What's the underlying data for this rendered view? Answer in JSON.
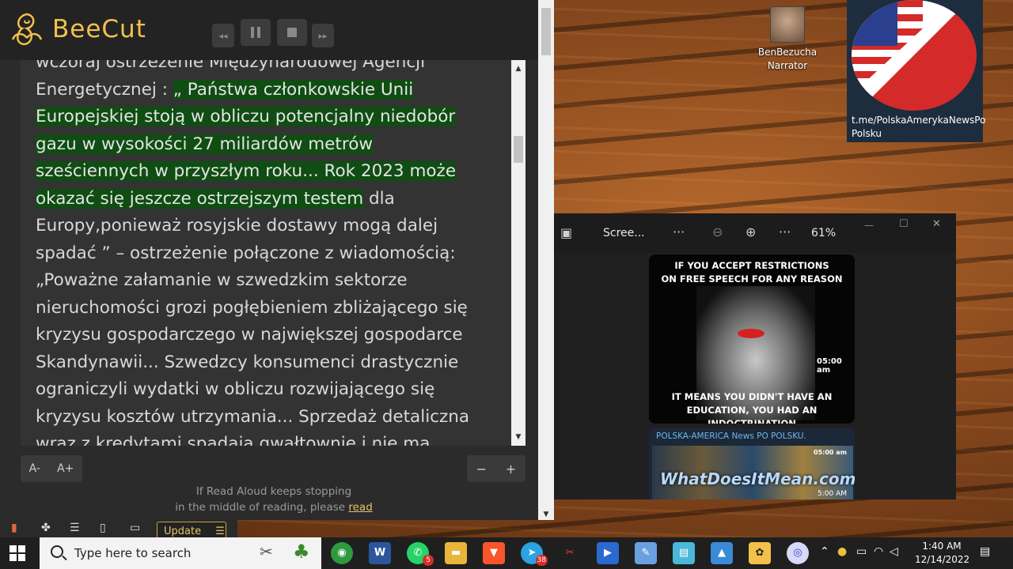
{
  "reader": {
    "app_name": "BeeCut",
    "text_line_first": "wczoraj ostrzeżenie Międzynarodowej Agencji",
    "text_line_2a": "Energetycznej : ",
    "text_hl_1": "„ Państwa członkowskie Unii",
    "text_hl_2": "Europejskiej stoją w obliczu potencjalny niedobór",
    "text_hl_3": "gazu w wysokości 27 miliardów metrów",
    "text_hl_4": "sześciennych w przyszłym roku... Rok 2023 może",
    "text_hl_5": "okazać się jeszcze ostrzejszym testem",
    "text_line_5b": " dla",
    "text_rest": "Europy,ponieważ rosyjskie dostawy mogą dalej\nspadać ” – ostrzeżenie połączone z wiadomością:\n„Poważne załamanie w szwedzkim sektorze\nnieruchomości grozi pogłębieniem zbliżającego się\nkryzysu gospodarczego w największej gospodarce\nSkandynawii... Szwedzcy konsumenci drastycznie\nograniczyli wydatki w obliczu rozwijającego się\nkryzysu kosztów utrzymania... Sprzedaż detaliczna\nwraz z kredytami spadaja gwałtownie i nie ma",
    "font_smaller": "A-",
    "font_larger": "A+",
    "minus": "−",
    "plus": "+",
    "notice_line1": "If Read Aloud keeps stopping",
    "notice_line2": "in the middle of reading, please ",
    "notice_link": "read",
    "update_label": "Update"
  },
  "desktop": {
    "narrator_name": "BenBezucha",
    "narrator_role": "Narrator",
    "flag_label": "t.me/PolskaAmerykaNewsPo Polsku"
  },
  "photos": {
    "title": "Scree...",
    "more1": "···",
    "more2": "···",
    "zoom": "61%",
    "minimize": "—",
    "maximize": "☐",
    "close": "✕",
    "meme_top": "IF YOU ACCEPT RESTRICTIONS\nON FREE SPEECH FOR ANY REASON",
    "meme_bottom": "IT MEANS YOU DIDN'T HAVE AN\nEDUCATION, YOU HAD AN INDOCTRINATION",
    "meme_time": "05:00 am",
    "channel_title": "POLSKA-AMERICA News PO POLSKU.",
    "channel_watermark": "WhatDoesItMean.com",
    "channel_time_top": "05:00 am",
    "channel_time_bottom": "5:00 AM"
  },
  "taskbar": {
    "search_placeholder": "Type here to search",
    "telegram_badge": "38",
    "whatsapp_badge": "5",
    "time": "1:40 AM",
    "date": "12/14/2022"
  },
  "colors": {
    "highlight": "#0f4d12",
    "brand": "#f2c14a",
    "link": "#e6c46a"
  }
}
